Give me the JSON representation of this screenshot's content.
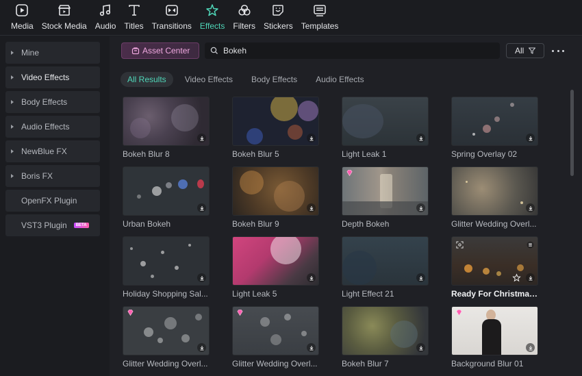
{
  "toolbar": [
    {
      "label": "Media",
      "icon": "media-icon",
      "active": false
    },
    {
      "label": "Stock Media",
      "icon": "stock-media-icon",
      "active": false
    },
    {
      "label": "Audio",
      "icon": "music-note-icon",
      "active": false
    },
    {
      "label": "Titles",
      "icon": "text-t-icon",
      "active": false
    },
    {
      "label": "Transitions",
      "icon": "transition-icon",
      "active": false
    },
    {
      "label": "Effects",
      "icon": "sparkle-star-icon",
      "active": true
    },
    {
      "label": "Filters",
      "icon": "filter-circles-icon",
      "active": false
    },
    {
      "label": "Stickers",
      "icon": "sticker-icon",
      "active": false
    },
    {
      "label": "Templates",
      "icon": "templates-icon",
      "active": false
    }
  ],
  "sidebar": {
    "items": [
      {
        "label": "Mine",
        "expandable": true,
        "selected": false
      },
      {
        "label": "Video Effects",
        "expandable": true,
        "selected": true
      },
      {
        "label": "Body Effects",
        "expandable": true,
        "selected": false
      },
      {
        "label": "Audio Effects",
        "expandable": true,
        "selected": false
      },
      {
        "label": "NewBlue FX",
        "expandable": true,
        "selected": false
      },
      {
        "label": "Boris FX",
        "expandable": true,
        "selected": false
      },
      {
        "label": "OpenFX Plugin",
        "expandable": false,
        "selected": false
      },
      {
        "label": "VST3 Plugin",
        "expandable": false,
        "selected": false,
        "badge": "BETA"
      }
    ]
  },
  "header": {
    "asset_center_label": "Asset Center",
    "search_value": "Bokeh",
    "filter_label": "All"
  },
  "tabs": [
    {
      "label": "All Results",
      "active": true
    },
    {
      "label": "Video Effects",
      "active": false
    },
    {
      "label": "Body Effects",
      "active": false
    },
    {
      "label": "Audio Effects",
      "active": false
    }
  ],
  "colors": {
    "accent": "#4fd6b8",
    "asset_center": "#f0a9e0",
    "background": "#1f2025",
    "sidebar_item": "#26282d"
  },
  "effects": [
    {
      "name": "Bokeh Blur 8",
      "premium": false
    },
    {
      "name": "Bokeh Blur 5",
      "premium": false
    },
    {
      "name": "Light Leak 1",
      "premium": false
    },
    {
      "name": "Spring Overlay 02",
      "premium": false
    },
    {
      "name": "Urban Bokeh",
      "premium": false
    },
    {
      "name": "Bokeh Blur 9",
      "premium": false
    },
    {
      "name": "Depth Bokeh",
      "premium": true
    },
    {
      "name": "Glitter Wedding Overl...",
      "premium": false
    },
    {
      "name": "Holiday Shopping Sal...",
      "premium": false
    },
    {
      "name": "Light Leak 5",
      "premium": false
    },
    {
      "name": "Light Effect 21",
      "premium": false
    },
    {
      "name": "Ready For Christmas ...",
      "premium": false,
      "highlighted": true
    },
    {
      "name": "Glitter Wedding Overl...",
      "premium": true
    },
    {
      "name": "Glitter Wedding Overl...",
      "premium": true
    },
    {
      "name": "Bokeh Blur 7",
      "premium": false
    },
    {
      "name": "Background Blur 01",
      "premium": true
    }
  ]
}
